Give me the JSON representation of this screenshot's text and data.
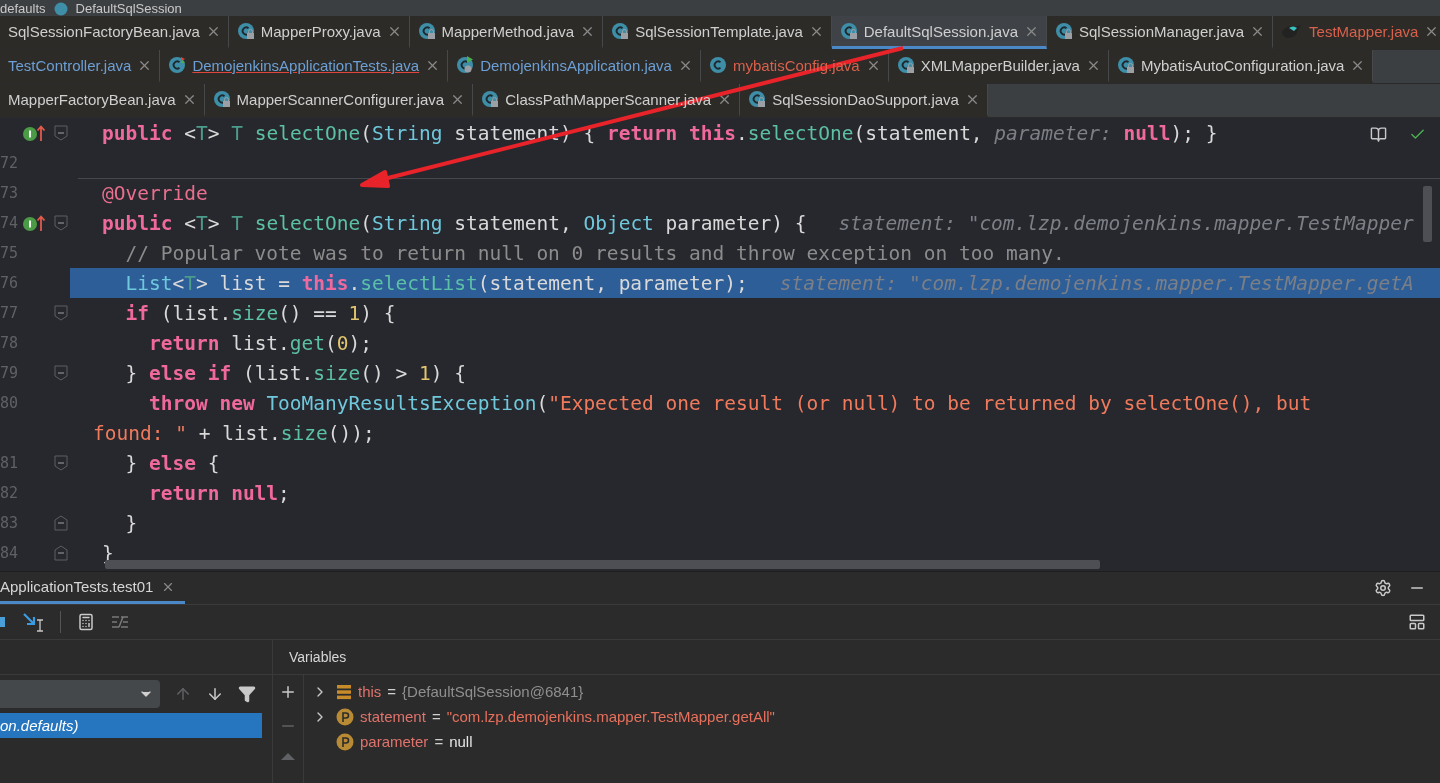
{
  "breadcrumb": [
    {
      "label": "defaults"
    },
    {
      "label": "DefaultSqlSession"
    }
  ],
  "tab_rows": [
    [
      {
        "label": "SqlSessionFactoryBean.java",
        "kind": "plain",
        "modified": false,
        "error": false,
        "has_errors": false,
        "selected": false
      },
      {
        "label": "MapperProxy.java",
        "kind": "locked",
        "modified": false,
        "error": false,
        "has_errors": false,
        "selected": false
      },
      {
        "label": "MapperMethod.java",
        "kind": "locked",
        "modified": false,
        "error": false,
        "has_errors": false,
        "selected": false
      },
      {
        "label": "SqlSessionTemplate.java",
        "kind": "locked",
        "modified": false,
        "error": false,
        "has_errors": false,
        "selected": false
      },
      {
        "label": "DefaultSqlSession.java",
        "kind": "locked",
        "modified": false,
        "error": false,
        "has_errors": false,
        "selected": true
      },
      {
        "label": "SqlSessionManager.java",
        "kind": "locked",
        "modified": false,
        "error": false,
        "has_errors": false,
        "selected": false
      },
      {
        "label": "TestMapper.java",
        "kind": "mapper",
        "modified": false,
        "error": true,
        "has_errors": false,
        "selected": false
      }
    ],
    [
      {
        "label": "TestController.java",
        "kind": "plain",
        "modified": true,
        "error": false,
        "has_errors": false,
        "selected": false
      },
      {
        "label": "DemojenkinsApplicationTests.java",
        "kind": "test",
        "modified": true,
        "error": false,
        "has_errors": true,
        "selected": false
      },
      {
        "label": "DemojenkinsApplication.java",
        "kind": "app",
        "modified": true,
        "error": false,
        "has_errors": false,
        "selected": false
      },
      {
        "label": "mybatisConfig.java",
        "kind": "class",
        "modified": false,
        "error": true,
        "has_errors": false,
        "selected": false
      },
      {
        "label": "XMLMapperBuilder.java",
        "kind": "locked",
        "modified": false,
        "error": false,
        "has_errors": false,
        "selected": false
      },
      {
        "label": "MybatisAutoConfiguration.java",
        "kind": "locked",
        "modified": false,
        "error": false,
        "has_errors": false,
        "selected": false
      }
    ],
    [
      {
        "label": "MapperFactoryBean.java",
        "kind": "plain",
        "modified": false,
        "error": false,
        "has_errors": false,
        "selected": false
      },
      {
        "label": "MapperScannerConfigurer.java",
        "kind": "locked",
        "modified": false,
        "error": false,
        "has_errors": false,
        "selected": false
      },
      {
        "label": "ClassPathMapperScanner.java",
        "kind": "locked",
        "modified": false,
        "error": false,
        "has_errors": false,
        "selected": false
      },
      {
        "label": "SqlSessionDaoSupport.java",
        "kind": "locked",
        "modified": false,
        "error": false,
        "has_errors": false,
        "selected": false
      }
    ]
  ],
  "code_lines": [
    {
      "override": true,
      "fold_start": true,
      "fold_end": false,
      "separator": false,
      "current": false,
      "tokens": [
        {
          "kind": "kw",
          "text": "public "
        },
        {
          "kind": "plain",
          "text": "<"
        },
        {
          "kind": "tparam",
          "text": "T"
        },
        {
          "kind": "plain",
          "text": "> "
        },
        {
          "kind": "tparam",
          "text": "T "
        },
        {
          "kind": "method",
          "text": "selectOne"
        },
        {
          "kind": "plain",
          "text": "("
        },
        {
          "kind": "type",
          "text": "String"
        },
        {
          "kind": "plain",
          "text": " statement) { "
        },
        {
          "kind": "kw",
          "text": "return this"
        },
        {
          "kind": "plain",
          "text": "."
        },
        {
          "kind": "method",
          "text": "selectOne"
        },
        {
          "kind": "plain",
          "text": "(statement, "
        },
        {
          "kind": "hint",
          "text": "parameter:"
        },
        {
          "kind": "kw",
          "text": " null"
        },
        {
          "kind": "plain",
          "text": "); }"
        }
      ]
    },
    {
      "number": "72",
      "override": false,
      "fold_start": false,
      "fold_end": false,
      "separator": false,
      "current": false
    },
    {
      "number": "73",
      "override": false,
      "fold_start": false,
      "fold_end": false,
      "separator": true,
      "current": false,
      "tokens": [
        {
          "kind": "annotation",
          "text": "@Override"
        }
      ]
    },
    {
      "number": "74",
      "override": true,
      "fold_start": true,
      "fold_end": false,
      "separator": false,
      "current": false,
      "tokens": [
        {
          "kind": "kw",
          "text": "public "
        },
        {
          "kind": "plain",
          "text": "<"
        },
        {
          "kind": "tparam",
          "text": "T"
        },
        {
          "kind": "plain",
          "text": "> "
        },
        {
          "kind": "tparam",
          "text": "T "
        },
        {
          "kind": "method",
          "text": "selectOne"
        },
        {
          "kind": "plain",
          "text": "("
        },
        {
          "kind": "type",
          "text": "String"
        },
        {
          "kind": "plain",
          "text": " statement, "
        },
        {
          "kind": "type",
          "text": "Object"
        },
        {
          "kind": "plain",
          "text": " parameter) {"
        },
        {
          "kind": "hint",
          "text": "statement: \"com.lzp.demojenkins.mapper.TestMapper"
        }
      ]
    },
    {
      "number": "75",
      "override": false,
      "fold_start": false,
      "fold_end": false,
      "separator": false,
      "current": false,
      "tokens": [
        {
          "kind": "comment",
          "text": "  // Popular vote was to return null on 0 results and throw exception on too many."
        }
      ]
    },
    {
      "number": "76",
      "override": false,
      "fold_start": false,
      "fold_end": false,
      "separator": false,
      "current": true,
      "tokens": [
        {
          "kind": "type",
          "text": "  List"
        },
        {
          "kind": "plain",
          "text": "<"
        },
        {
          "kind": "tparam",
          "text": "T"
        },
        {
          "kind": "plain",
          "text": "> list = "
        },
        {
          "kind": "kw",
          "text": "this"
        },
        {
          "kind": "plain",
          "text": "."
        },
        {
          "kind": "method",
          "text": "selectList"
        },
        {
          "kind": "plain",
          "text": "(statement, parameter);"
        },
        {
          "kind": "hint",
          "text": "statement: \"com.lzp.demojenkins.mapper.TestMapper.getA"
        }
      ]
    },
    {
      "number": "77",
      "override": false,
      "fold_start": true,
      "fold_end": false,
      "separator": false,
      "current": false,
      "tokens": [
        {
          "kind": "kw",
          "text": "  if"
        },
        {
          "kind": "plain",
          "text": " (list."
        },
        {
          "kind": "method",
          "text": "size"
        },
        {
          "kind": "plain",
          "text": "() == "
        },
        {
          "kind": "num",
          "text": "1"
        },
        {
          "kind": "plain",
          "text": ") {"
        }
      ]
    },
    {
      "number": "78",
      "override": false,
      "fold_start": false,
      "fold_end": false,
      "separator": false,
      "current": false,
      "tokens": [
        {
          "kind": "kw",
          "text": "    return"
        },
        {
          "kind": "plain",
          "text": " list."
        },
        {
          "kind": "method",
          "text": "get"
        },
        {
          "kind": "plain",
          "text": "("
        },
        {
          "kind": "num",
          "text": "0"
        },
        {
          "kind": "plain",
          "text": ");"
        }
      ]
    },
    {
      "number": "79",
      "override": false,
      "fold_start": true,
      "fold_end": true,
      "separator": false,
      "current": false,
      "tokens": [
        {
          "kind": "plain",
          "text": "  } "
        },
        {
          "kind": "kw",
          "text": "else if"
        },
        {
          "kind": "plain",
          "text": " (list."
        },
        {
          "kind": "method",
          "text": "size"
        },
        {
          "kind": "plain",
          "text": "() > "
        },
        {
          "kind": "num",
          "text": "1"
        },
        {
          "kind": "plain",
          "text": ") {"
        }
      ]
    },
    {
      "number": "80",
      "override": false,
      "fold_start": false,
      "fold_end": false,
      "separator": false,
      "current": false,
      "tokens": [
        {
          "kind": "kw",
          "text": "    throw new "
        },
        {
          "kind": "type",
          "text": "TooManyResultsException"
        },
        {
          "kind": "plain",
          "text": "("
        },
        {
          "kind": "str",
          "text": "\"Expected one result (or null) to be returned by selectOne(), but"
        }
      ]
    },
    {
      "override": false,
      "fold_start": false,
      "fold_end": false,
      "separator": false,
      "current": false,
      "tokens": [
        {
          "kind": "str",
          "text": "found: \""
        },
        {
          "kind": "plain",
          "text": " + list."
        },
        {
          "kind": "method",
          "text": "size"
        },
        {
          "kind": "plain",
          "text": "());"
        }
      ]
    },
    {
      "number": "81",
      "override": false,
      "fold_start": true,
      "fold_end": true,
      "separator": false,
      "current": false,
      "tokens": [
        {
          "kind": "plain",
          "text": "  } "
        },
        {
          "kind": "kw",
          "text": "else"
        },
        {
          "kind": "plain",
          "text": " {"
        }
      ]
    },
    {
      "number": "82",
      "override": false,
      "fold_start": false,
      "fold_end": false,
      "separator": false,
      "current": false,
      "tokens": [
        {
          "kind": "kw",
          "text": "    return null"
        },
        {
          "kind": "plain",
          "text": ";"
        }
      ]
    },
    {
      "number": "83",
      "override": false,
      "fold_start": false,
      "fold_end": true,
      "separator": false,
      "current": false,
      "tokens": [
        {
          "kind": "plain",
          "text": "  }"
        }
      ]
    },
    {
      "number": "84",
      "override": false,
      "fold_start": false,
      "fold_end": true,
      "separator": false,
      "current": false,
      "tokens": [
        {
          "kind": "plain",
          "text": "}"
        }
      ]
    }
  ],
  "debug": {
    "tab": {
      "label": "ApplicationTests.test01",
      "selected": true
    },
    "frames": {
      "selected_frame": {
        "label": "on.defaults)",
        "selected": true
      }
    },
    "variables": {
      "title": "Variables",
      "items": [
        {
          "name": "this",
          "operator": "=",
          "value": "{DefaultSqlSession@6841}",
          "kind": "object",
          "expandable": true
        },
        {
          "name": "statement",
          "operator": "=",
          "value": "\"com.lzp.demojenkins.mapper.TestMapper.getAll\"",
          "kind": "string-param",
          "expandable": true
        },
        {
          "name": "parameter",
          "operator": "=",
          "value": "null",
          "kind": "param",
          "expandable": false
        }
      ]
    }
  }
}
